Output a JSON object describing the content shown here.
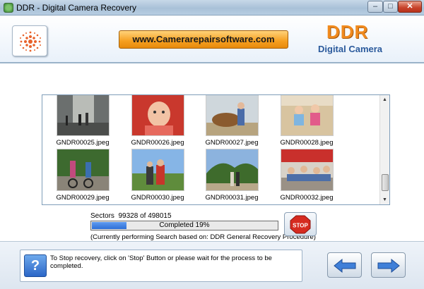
{
  "window": {
    "title": "DDR - Digital Camera Recovery",
    "controls": {
      "minimize": "–",
      "maximize": "□",
      "close": "✕"
    }
  },
  "header": {
    "website": "www.Camerarepairsoftware.com",
    "brand": "DDR",
    "brand_subtitle": "Digital Camera",
    "logo_icon": "dot-burst-icon",
    "accent_color": "#f08a1e",
    "brand_blue": "#2b5a9c"
  },
  "gallery": {
    "rows": [
      {
        "items": [
          {
            "filename": "GNDR00025.jpeg",
            "scene": "corridor"
          },
          {
            "filename": "GNDR00026.jpeg",
            "scene": "baby"
          },
          {
            "filename": "GNDR00027.jpeg",
            "scene": "pony"
          },
          {
            "filename": "GNDR00028.jpeg",
            "scene": "beach"
          }
        ]
      },
      {
        "items": [
          {
            "filename": "GNDR00029.jpeg",
            "scene": "bikes"
          },
          {
            "filename": "GNDR00030.jpeg",
            "scene": "family"
          },
          {
            "filename": "GNDR00031.jpeg",
            "scene": "hills"
          },
          {
            "filename": "GNDR00032.jpeg",
            "scene": "crowd"
          }
        ]
      }
    ]
  },
  "progress": {
    "sectors_label": "Sectors",
    "sectors_done": "99328",
    "sectors_of": "of",
    "sectors_total": "498015",
    "percent": 19,
    "completed_text": "Completed 19%",
    "currently_text": "(Currently performing Search based on:  DDR General Recovery Procedure)",
    "fill_color": "#2e6fd6"
  },
  "buttons": {
    "stop_label": "STOP",
    "help_label": "?",
    "back_icon": "arrow-left-icon",
    "next_icon": "arrow-right-icon"
  },
  "message": {
    "text": "To Stop recovery, click on 'Stop' Button or please wait for the process to be completed."
  }
}
